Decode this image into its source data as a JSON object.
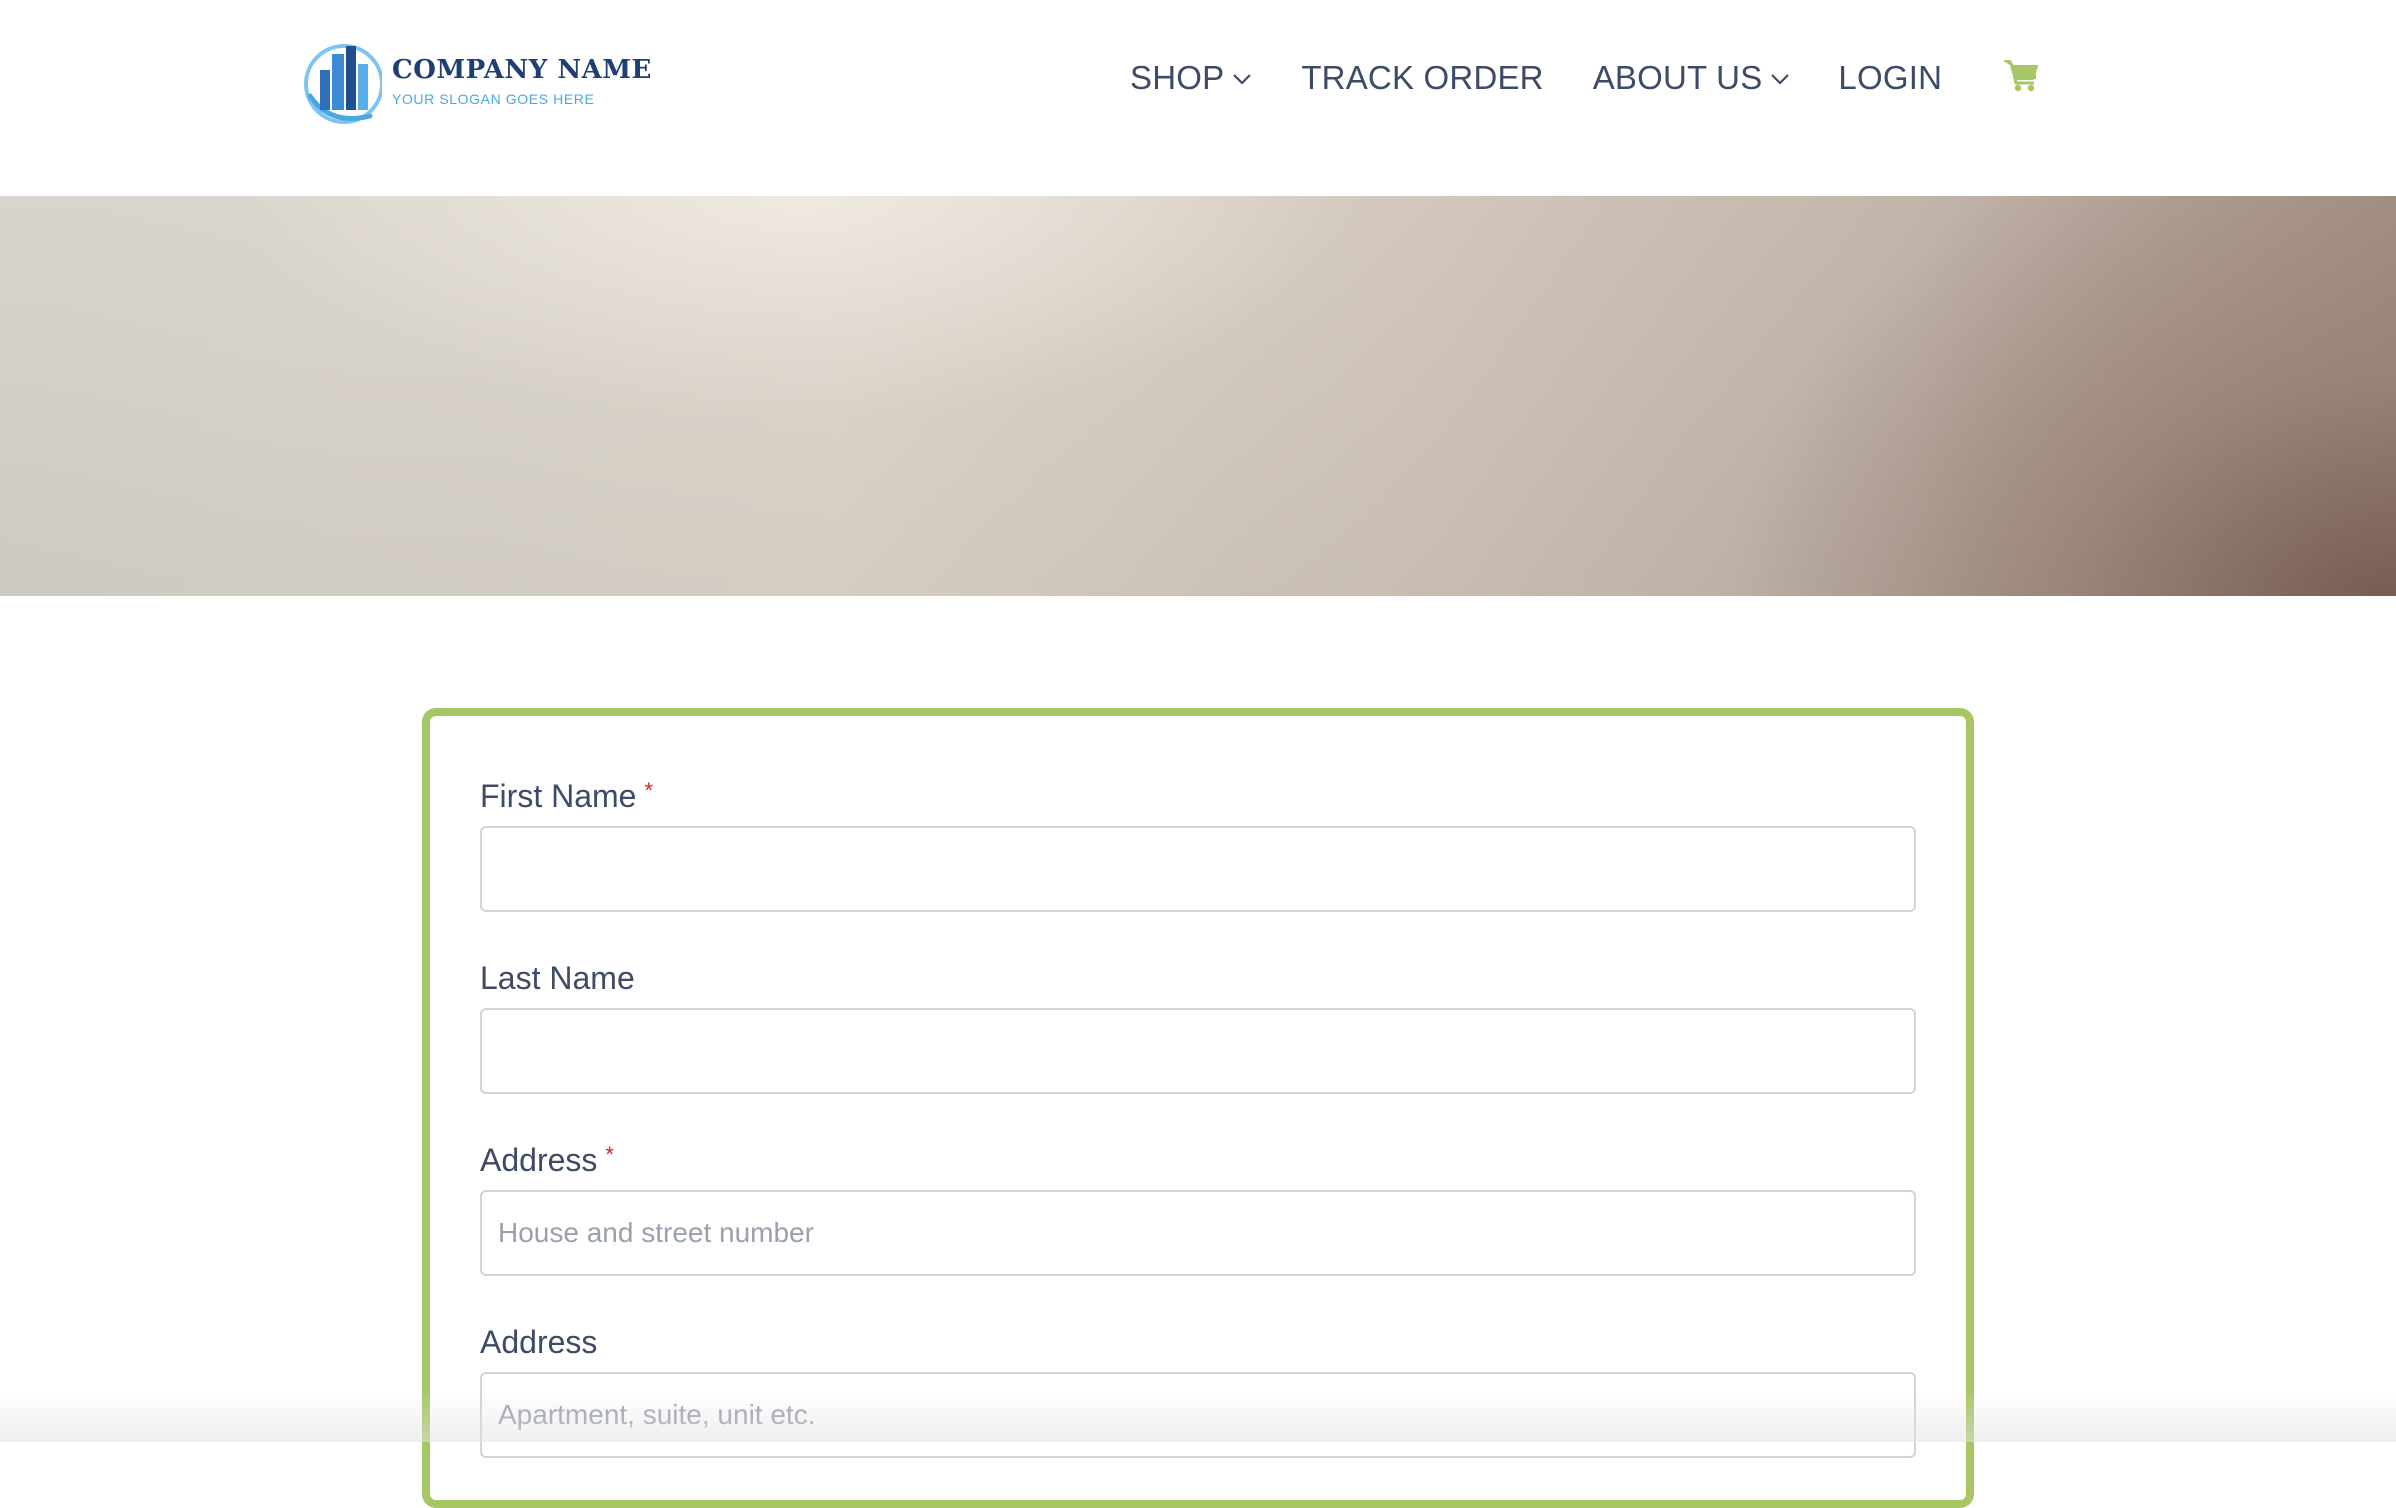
{
  "brand": {
    "name": "COMPANY NAME",
    "slogan": "YOUR SLOGAN GOES HERE",
    "logo_icon": "building-icon",
    "colors": {
      "primary": "#1f3e73",
      "secondary": "#4aa8e0"
    }
  },
  "nav": {
    "items": [
      {
        "label": "SHOP",
        "has_dropdown": true
      },
      {
        "label": "TRACK ORDER",
        "has_dropdown": false
      },
      {
        "label": "ABOUT US",
        "has_dropdown": true
      },
      {
        "label": "LOGIN",
        "has_dropdown": false
      }
    ],
    "cart_icon": "shopping-cart-icon",
    "cart_color": "#a6c763"
  },
  "hero": {
    "type": "gradient-banner"
  },
  "form": {
    "accent_color": "#a6c763",
    "required_marker": "*",
    "fields": [
      {
        "label": "First Name",
        "required": true,
        "value": "",
        "placeholder": ""
      },
      {
        "label": "Last Name",
        "required": false,
        "value": "",
        "placeholder": ""
      },
      {
        "label": "Address",
        "required": true,
        "value": "",
        "placeholder": "House and street number"
      },
      {
        "label": "Address",
        "required": false,
        "value": "",
        "placeholder": "Apartment, suite, unit etc."
      }
    ]
  }
}
